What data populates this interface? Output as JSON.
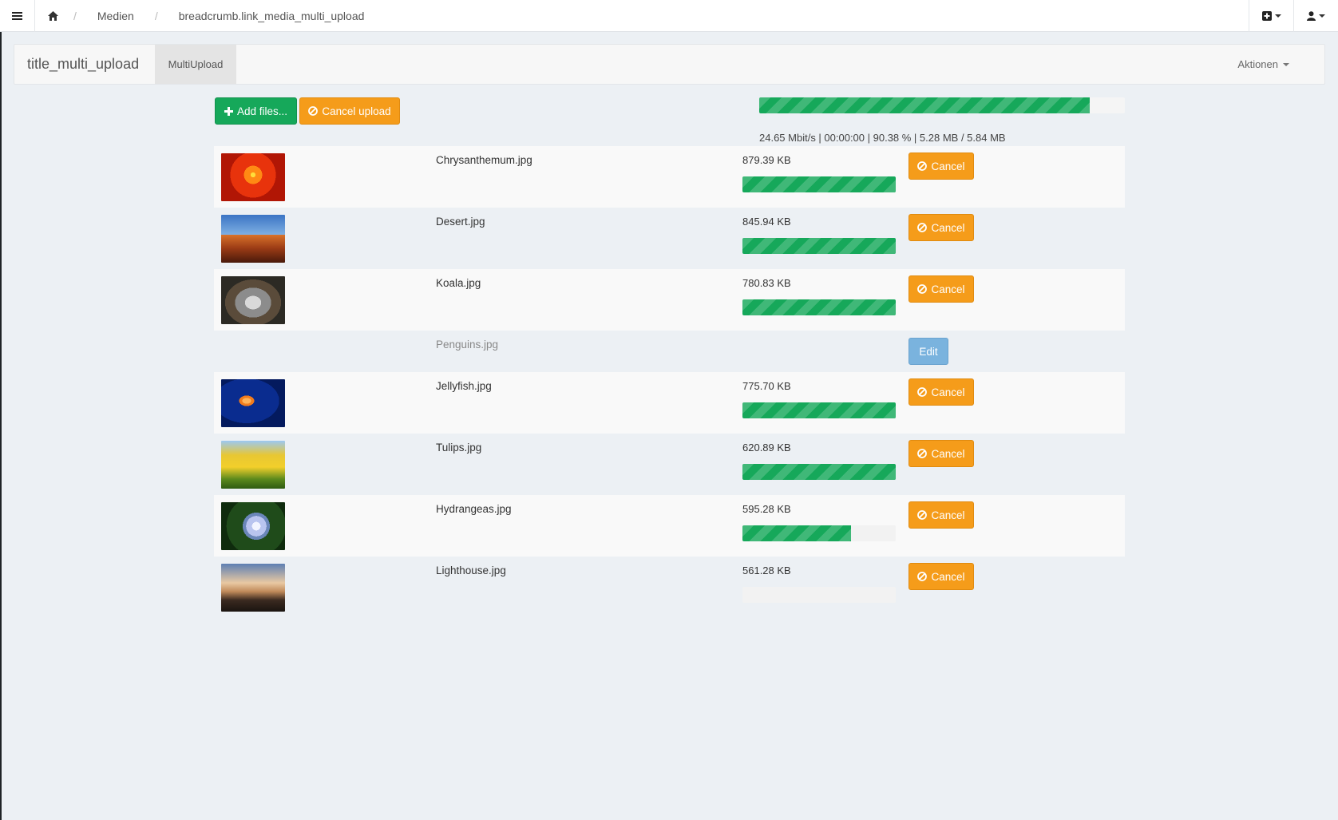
{
  "colors": {
    "accent_green": "#16a85a",
    "accent_orange": "#f59c1a",
    "edit_blue": "#7ab3de",
    "page_bg": "#ecf0f4"
  },
  "nav": {
    "menu_icon": "hamburger-icon",
    "home_icon": "home-icon",
    "breadcrumb": [
      "Medien",
      "breadcrumb.link_media_multi_upload"
    ],
    "add_menu_icon": "plus-square-icon",
    "user_menu_icon": "user-icon"
  },
  "header": {
    "title": "title_multi_upload",
    "active_tab": "MultiUpload",
    "actions_label": "Aktionen"
  },
  "toolbar": {
    "add_files_label": "Add files...",
    "cancel_upload_label": "Cancel upload"
  },
  "overall_progress": {
    "percent": 90.38,
    "stats_text": "24.65 Mbit/s | 00:00:00 | 90.38 % | 5.28 MB / 5.84 MB"
  },
  "files": [
    {
      "name": "Chrysanthemum.jpg",
      "size": "879.39 KB",
      "progress": 100,
      "action": "Cancel",
      "thumb": "t-chrys"
    },
    {
      "name": "Desert.jpg",
      "size": "845.94 KB",
      "progress": 100,
      "action": "Cancel",
      "thumb": "t-desert"
    },
    {
      "name": "Koala.jpg",
      "size": "780.83 KB",
      "progress": 100,
      "action": "Cancel",
      "thumb": "t-koala"
    },
    {
      "name": "Penguins.jpg",
      "size": "",
      "progress": null,
      "action": "Edit",
      "thumb": ""
    },
    {
      "name": "Jellyfish.jpg",
      "size": "775.70 KB",
      "progress": 100,
      "action": "Cancel",
      "thumb": "t-jelly"
    },
    {
      "name": "Tulips.jpg",
      "size": "620.89 KB",
      "progress": 100,
      "action": "Cancel",
      "thumb": "t-tulips"
    },
    {
      "name": "Hydrangeas.jpg",
      "size": "595.28 KB",
      "progress": 71,
      "action": "Cancel",
      "thumb": "t-hydra"
    },
    {
      "name": "Lighthouse.jpg",
      "size": "561.28 KB",
      "progress": 0,
      "action": "Cancel",
      "thumb": "t-light"
    }
  ]
}
